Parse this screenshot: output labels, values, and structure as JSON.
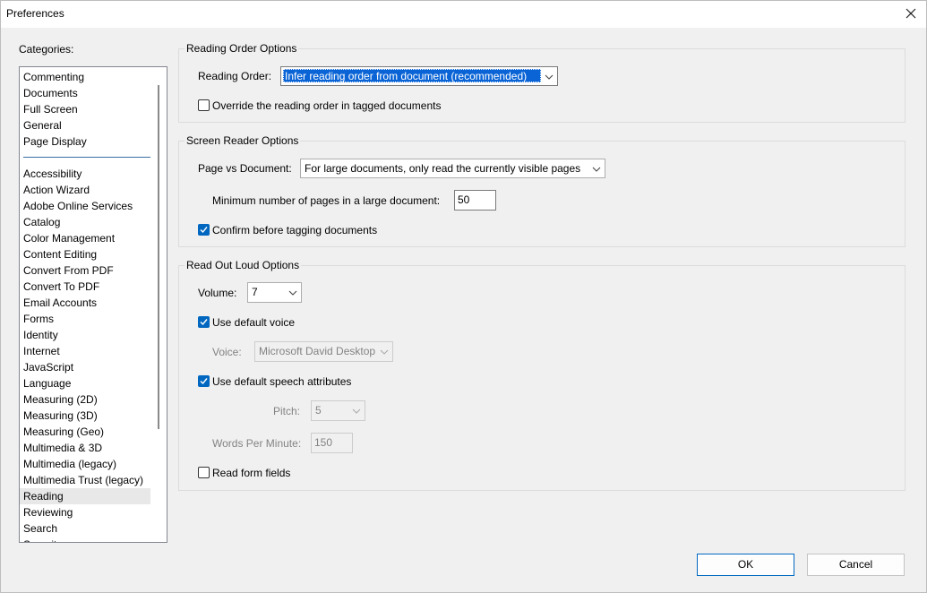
{
  "window": {
    "title": "Preferences"
  },
  "categories": {
    "label": "Categories:",
    "top_items": [
      "Commenting",
      "Documents",
      "Full Screen",
      "General",
      "Page Display"
    ],
    "items": [
      "Accessibility",
      "Action Wizard",
      "Adobe Online Services",
      "Catalog",
      "Color Management",
      "Content Editing",
      "Convert From PDF",
      "Convert To PDF",
      "Email Accounts",
      "Forms",
      "Identity",
      "Internet",
      "JavaScript",
      "Language",
      "Measuring (2D)",
      "Measuring (3D)",
      "Measuring (Geo)",
      "Multimedia & 3D",
      "Multimedia (legacy)",
      "Multimedia Trust (legacy)",
      "Reading",
      "Reviewing",
      "Search",
      "Security"
    ],
    "selected": "Reading"
  },
  "reading_order": {
    "group_label": "Reading Order Options",
    "order_label": "Reading Order:",
    "order_value": "Infer reading order from document (recommended)",
    "override_label": "Override the reading order in tagged documents",
    "override_checked": false
  },
  "screen_reader": {
    "group_label": "Screen Reader Options",
    "page_vs_doc_label": "Page vs Document:",
    "page_vs_doc_value": "For large documents, only read the currently visible pages",
    "min_pages_label": "Minimum number of pages in a large document:",
    "min_pages_value": "50",
    "confirm_label": "Confirm before tagging documents",
    "confirm_checked": true
  },
  "read_out_loud": {
    "group_label": "Read Out Loud Options",
    "volume_label": "Volume:",
    "volume_value": "7",
    "default_voice_label": "Use default voice",
    "default_voice_checked": true,
    "voice_label": "Voice:",
    "voice_value": "Microsoft David Desktop",
    "default_speech_label": "Use default speech attributes",
    "default_speech_checked": true,
    "pitch_label": "Pitch:",
    "pitch_value": "5",
    "wpm_label": "Words Per Minute:",
    "wpm_value": "150",
    "form_fields_label": "Read form fields",
    "form_fields_checked": false
  },
  "buttons": {
    "ok": "OK",
    "cancel": "Cancel"
  },
  "colors": {
    "accent": "#0067c0",
    "selection": "#0a64d6",
    "window_bg": "#f0f0f0"
  }
}
